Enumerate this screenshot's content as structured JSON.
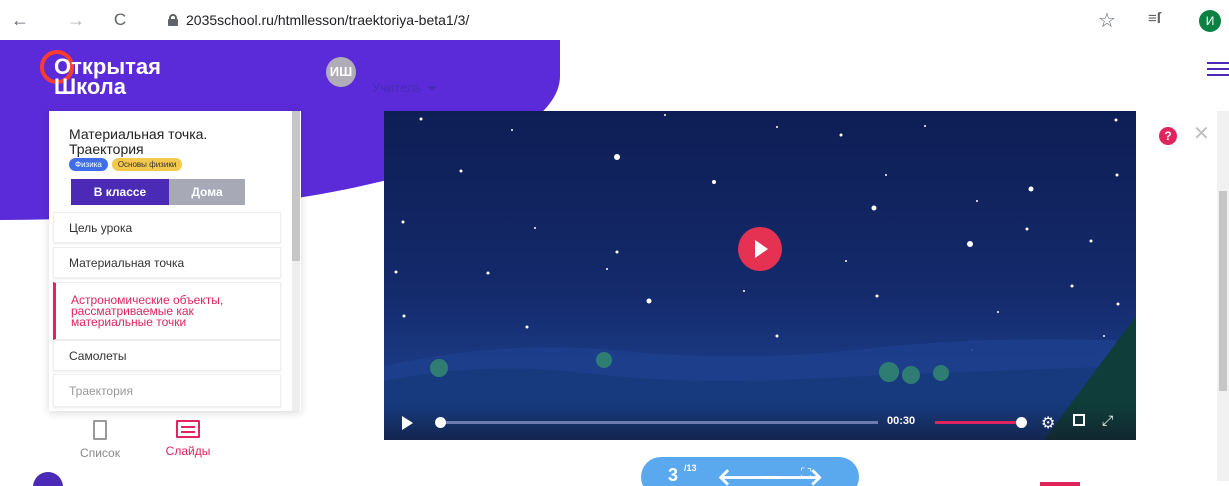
{
  "browser": {
    "url": "2035school.ru/htmllesson/traektoriya-beta1/3/",
    "back_glyph": "←",
    "forward_glyph": "→",
    "reload_glyph": "C",
    "star_glyph": "☆",
    "playlist_glyph": "≡ſ",
    "profile_initial": "И",
    "profile_color": "#0b8043"
  },
  "header": {
    "logo_line1": "Открытая",
    "logo_line2": "Школа",
    "user_initials": "ИШ",
    "role": "Учитель",
    "accent_color": "#5b2bd9"
  },
  "sidebar": {
    "lesson_title": "Материальная точка. Траектория",
    "tags": [
      "Физика",
      "Основы физики"
    ],
    "tabs": [
      "В классе",
      "Дома"
    ],
    "items": [
      "Цель урока",
      "Материальная точка",
      "Астрономические объекты, рассматриваемые как материальные точки",
      "Самолеты",
      "Траектория"
    ],
    "active_index": 2
  },
  "view_switch": {
    "list_label": "Список",
    "slides_label": "Слайды"
  },
  "video": {
    "time": "00:30",
    "progress": 0.01,
    "volume": 0.95
  },
  "slide_nav": {
    "current": "3",
    "total": "/13"
  },
  "help_glyph": "?",
  "close_glyph": "✕"
}
